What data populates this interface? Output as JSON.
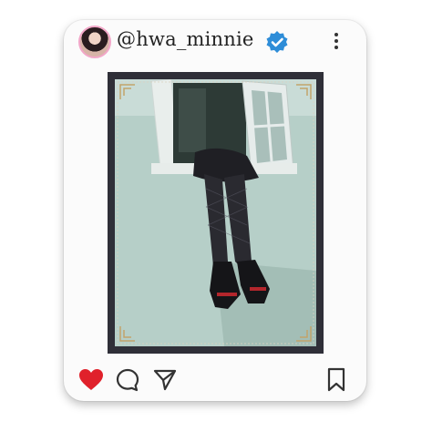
{
  "post": {
    "username": "@hwa_minnie",
    "verified": true,
    "liked": true
  },
  "icons": {
    "avatar": "profile-photo",
    "verified": "verified-badge-icon",
    "more": "more-vertical-icon",
    "like": "heart-icon",
    "comment": "comment-bubble-icon",
    "share": "send-icon",
    "save": "bookmark-icon"
  },
  "colors": {
    "like": "#e0212b",
    "verified": "#2e8dd8",
    "frame": "#2f2f38",
    "photo_wall": "#b9d1ca"
  }
}
